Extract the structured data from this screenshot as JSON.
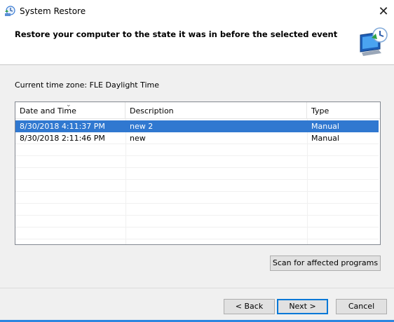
{
  "window": {
    "title": "System Restore",
    "close_glyph": "✕",
    "app_icon": "system-restore-icon"
  },
  "header": {
    "heading": "Restore your computer to the state it was in before the selected event",
    "icon": "restore-monitor-icon"
  },
  "timezone_label": "Current time zone: FLE Daylight Time",
  "restore_points": {
    "columns": [
      {
        "label": "Date and Time"
      },
      {
        "label": "Description"
      },
      {
        "label": "Type"
      }
    ],
    "sort_indicator": "⌄",
    "rows": [
      {
        "date": "8/30/2018 4:11:37 PM",
        "description": "new 2",
        "type": "Manual",
        "selected": true
      },
      {
        "date": "8/30/2018 2:11:46 PM",
        "description": "new",
        "type": "Manual",
        "selected": false
      }
    ]
  },
  "buttons": {
    "scan": "Scan for affected programs",
    "back": "< Back",
    "next": "Next >",
    "cancel": "Cancel"
  },
  "colors": {
    "selection": "#3078d0",
    "accent": "#2b86e0",
    "dialog_bg": "#f0f0f0"
  }
}
